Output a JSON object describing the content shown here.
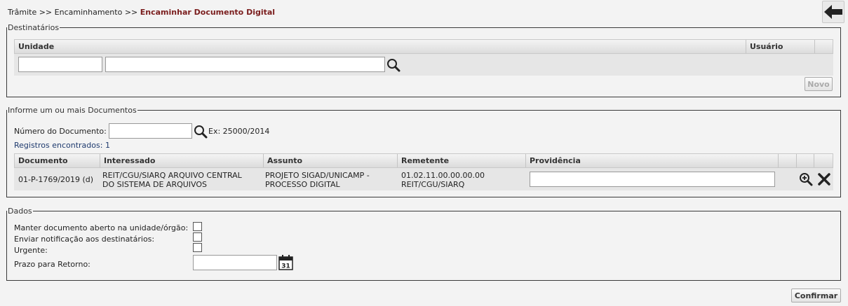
{
  "breadcrumb": {
    "part1": "Trâmite",
    "sep1": " >> ",
    "part2": "Encaminhamento",
    "sep2": " >> ",
    "current": "Encaminhar Documento Digital"
  },
  "destinatarios": {
    "legend": "Destinatários",
    "col_unidade": "Unidade",
    "col_usuario": "Usuário",
    "unidade_code_value": "",
    "unidade_name_value": "",
    "novo_label": "Novo"
  },
  "documentos": {
    "legend": "Informe um ou mais Documentos",
    "numero_label": "Número do Documento:",
    "numero_value": "",
    "example": "Ex: 25000/2014",
    "registros": "Registros encontrados: 1",
    "columns": [
      "Documento",
      "Interessado",
      "Assunto",
      "Remetente",
      "Providência"
    ],
    "rows": [
      {
        "documento": "01-P-1769/2019 (d)",
        "interessado_l1": "REIT/CGU/SIARQ ARQUIVO CENTRAL",
        "interessado_l2": "DO SISTEMA DE ARQUIVOS",
        "assunto_l1": "PROJETO SIGAD/UNICAMP -",
        "assunto_l2": "PROCESSO DIGITAL",
        "remetente_l1": "01.02.11.00.00.00.00",
        "remetente_l2": "REIT/CGU/SIARQ",
        "providencia_value": ""
      }
    ]
  },
  "dados": {
    "legend": "Dados",
    "manter_label": "Manter documento aberto na unidade/órgão:",
    "notificacao_label": "Enviar notificação aos destinatários:",
    "urgente_label": "Urgente:",
    "prazo_label": "Prazo para Retorno:",
    "prazo_value": "",
    "calendar_day": "31"
  },
  "confirmar_label": "Confirmar",
  "icons": {
    "back": "arrow-left-icon",
    "search": "magnifier-icon",
    "zoom": "zoom-in-icon",
    "remove": "close-icon",
    "calendar": "calendar-icon"
  },
  "colors": {
    "breadcrumb_current": "#7a1d1d",
    "link": "#1e3a6e"
  }
}
